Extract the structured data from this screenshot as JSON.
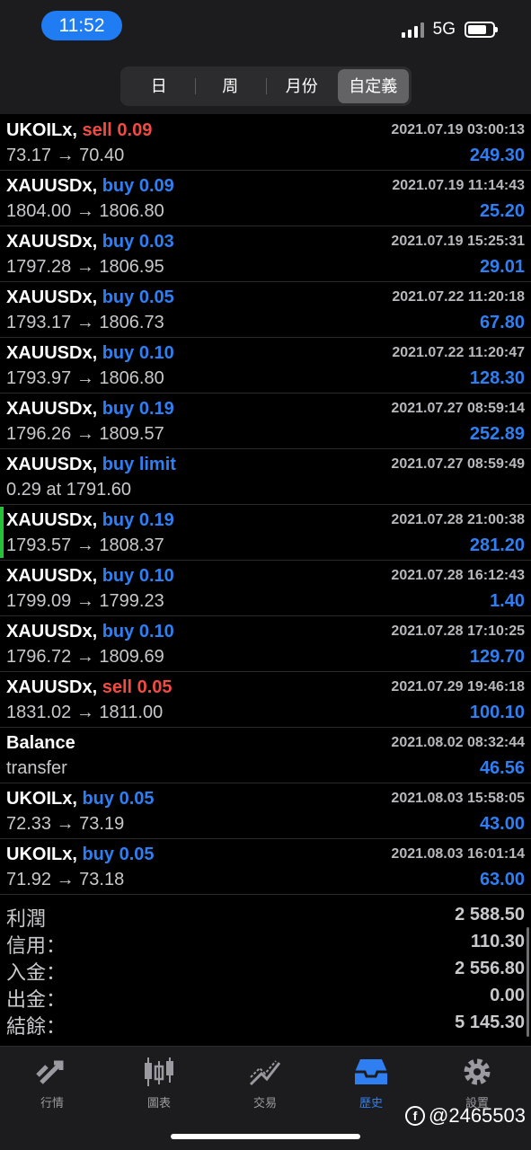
{
  "status_bar": {
    "time": "11:52",
    "network": "5G",
    "battery_level": 0.75
  },
  "period_tabs": [
    {
      "label": "日",
      "active": false
    },
    {
      "label": "周",
      "active": false
    },
    {
      "label": "月份",
      "active": false
    },
    {
      "label": "自定義",
      "active": true
    }
  ],
  "orders": [
    {
      "symbol": "UKOILx,",
      "side": "sell 0.09",
      "side_type": "sell",
      "date": "2021.07.19 03:00:13",
      "prices": "73.17 → 70.40",
      "profit": "249.30"
    },
    {
      "symbol": "XAUUSDx,",
      "side": "buy 0.09",
      "side_type": "buy",
      "date": "2021.07.19 11:14:43",
      "prices": "1804.00 → 1806.80",
      "profit": "25.20"
    },
    {
      "symbol": "XAUUSDx,",
      "side": "buy 0.03",
      "side_type": "buy",
      "date": "2021.07.19 15:25:31",
      "prices": "1797.28 → 1806.95",
      "profit": "29.01"
    },
    {
      "symbol": "XAUUSDx,",
      "side": "buy 0.05",
      "side_type": "buy",
      "date": "2021.07.22 11:20:18",
      "prices": "1793.17 → 1806.73",
      "profit": "67.80"
    },
    {
      "symbol": "XAUUSDx,",
      "side": "buy 0.10",
      "side_type": "buy",
      "date": "2021.07.22 11:20:47",
      "prices": "1793.97 → 1806.80",
      "profit": "128.30"
    },
    {
      "symbol": "XAUUSDx,",
      "side": "buy 0.19",
      "side_type": "buy",
      "date": "2021.07.27 08:59:14",
      "prices": "1796.26 → 1809.57",
      "profit": "252.89"
    },
    {
      "symbol": "XAUUSDx,",
      "side": "buy limit",
      "side_type": "buy",
      "date": "2021.07.27 08:59:49",
      "prices": "0.29 at 1791.60",
      "profit": ""
    },
    {
      "symbol": "XAUUSDx,",
      "side": "buy 0.19",
      "side_type": "buy",
      "date": "2021.07.28 21:00:38",
      "prices": "1793.57 → 1808.37",
      "profit": "281.20",
      "marked": true
    },
    {
      "symbol": "XAUUSDx,",
      "side": "buy 0.10",
      "side_type": "buy",
      "date": "2021.07.28 16:12:43",
      "prices": "1799.09 → 1799.23",
      "profit": "1.40"
    },
    {
      "symbol": "XAUUSDx,",
      "side": "buy 0.10",
      "side_type": "buy",
      "date": "2021.07.28 17:10:25",
      "prices": "1796.72 → 1809.69",
      "profit": "129.70"
    },
    {
      "symbol": "XAUUSDx,",
      "side": "sell 0.05",
      "side_type": "sell",
      "date": "2021.07.29 19:46:18",
      "prices": "1831.02 → 1811.00",
      "profit": "100.10"
    },
    {
      "symbol": "Balance",
      "side": "",
      "side_type": "",
      "date": "2021.08.02 08:32:44",
      "prices": "transfer",
      "profit": "46.56"
    },
    {
      "symbol": "UKOILx,",
      "side": "buy 0.05",
      "side_type": "buy",
      "date": "2021.08.03 15:58:05",
      "prices": "72.33 → 73.19",
      "profit": "43.00"
    },
    {
      "symbol": "UKOILx,",
      "side": "buy 0.05",
      "side_type": "buy",
      "date": "2021.08.03 16:01:14",
      "prices": "71.92 → 73.18",
      "profit": "63.00"
    }
  ],
  "summary": [
    {
      "label": "利潤",
      "value": "2 588.50"
    },
    {
      "label": "信用：",
      "value": "110.30"
    },
    {
      "label": "入金：",
      "value": "2 556.80"
    },
    {
      "label": "出金：",
      "value": "0.00"
    },
    {
      "label": "結餘：",
      "value": "5 145.30"
    }
  ],
  "tabbar": [
    {
      "label": "行情",
      "icon": "quotes-arrows-icon",
      "active": false
    },
    {
      "label": "圖表",
      "icon": "candlestick-chart-icon",
      "active": false
    },
    {
      "label": "交易",
      "icon": "trade-chart-icon",
      "active": false
    },
    {
      "label": "歷史",
      "icon": "history-inbox-icon",
      "active": true
    },
    {
      "label": "設置",
      "icon": "gear-icon",
      "active": false
    }
  ],
  "watermark": "@2465503",
  "colors": {
    "accent_blue": "#2f7ff2",
    "sell_red": "#f24a44",
    "marker_green": "#25c239",
    "time_pill": "#1f7cf3"
  }
}
